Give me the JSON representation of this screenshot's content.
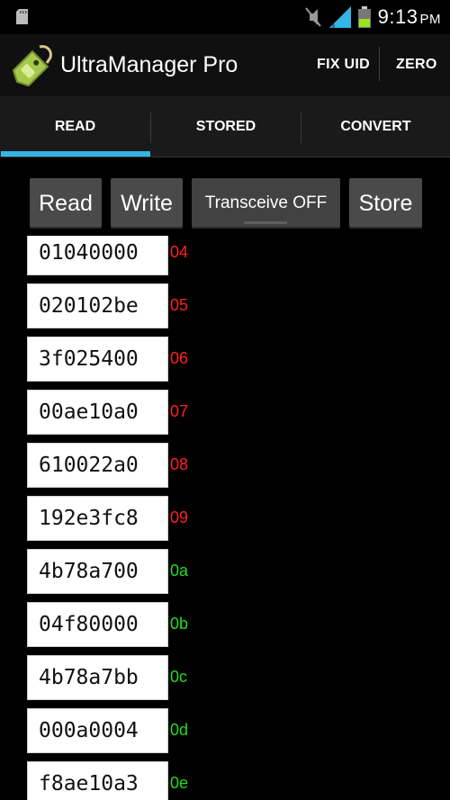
{
  "status_bar": {
    "time": "9:13",
    "ampm": "PM",
    "icons": [
      "sd-card-icon",
      "mute-icon",
      "signal-icon",
      "battery-icon"
    ]
  },
  "action_bar": {
    "title": "UltraManager Pro",
    "actions": [
      "FIX UID",
      "ZERO"
    ]
  },
  "tabs": [
    {
      "label": "READ",
      "selected": true
    },
    {
      "label": "STORED",
      "selected": false
    },
    {
      "label": "CONVERT",
      "selected": false
    }
  ],
  "buttons": {
    "read": "Read",
    "write": "Write",
    "transceive": "Transceive OFF",
    "store": "Store"
  },
  "rows": [
    {
      "value": "01040000",
      "index": "04",
      "color": "#ff2020"
    },
    {
      "value": "020102be",
      "index": "05",
      "color": "#ff2020"
    },
    {
      "value": "3f025400",
      "index": "06",
      "color": "#ff2020"
    },
    {
      "value": "00ae10a0",
      "index": "07",
      "color": "#ff2020"
    },
    {
      "value": "610022a0",
      "index": "08",
      "color": "#ff2020"
    },
    {
      "value": "192e3fc8",
      "index": "09",
      "color": "#ff2020"
    },
    {
      "value": "4b78a700",
      "index": "0a",
      "color": "#22dd22"
    },
    {
      "value": "04f80000",
      "index": "0b",
      "color": "#22dd22"
    },
    {
      "value": "4b78a7bb",
      "index": "0c",
      "color": "#22dd22"
    },
    {
      "value": "000a0004",
      "index": "0d",
      "color": "#22dd22"
    },
    {
      "value": "f8ae10a3",
      "index": "0e",
      "color": "#22dd22"
    }
  ],
  "colors": {
    "accent": "#33b5e5",
    "tab_bg": "#1a1a1a",
    "button_bg": "#4a4a4a"
  }
}
